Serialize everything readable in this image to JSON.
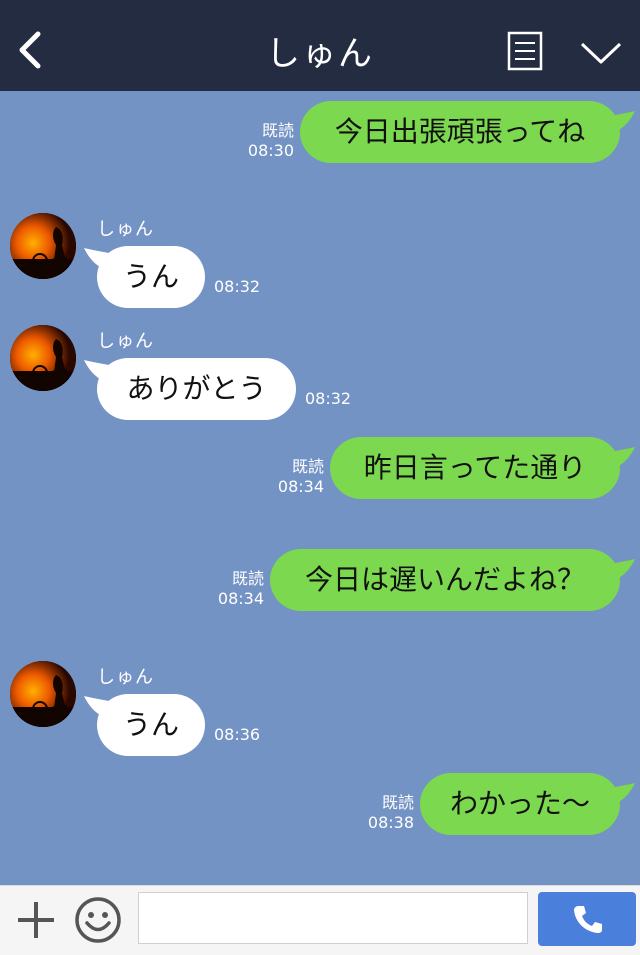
{
  "header": {
    "title": "しゅん"
  },
  "colors": {
    "background": "#7493c5",
    "outgoing": "#7cd84e",
    "incoming": "#ffffff",
    "header": "#232c40",
    "send": "#4a7fdc"
  },
  "messages": [
    {
      "dir": "out",
      "text": "今日出張頑張ってね",
      "read": "既読",
      "time": "08:30"
    },
    {
      "dir": "in",
      "sender": "しゅん",
      "text": "うん",
      "time": "08:32"
    },
    {
      "dir": "in",
      "sender": "しゅん",
      "text": "ありがとう",
      "time": "08:32"
    },
    {
      "dir": "out",
      "text": "昨日言ってた通り",
      "read": "既読",
      "time": "08:34"
    },
    {
      "dir": "out",
      "text": "今日は遅いんだよね？",
      "read": "既読",
      "time": "08:34"
    },
    {
      "dir": "in",
      "sender": "しゅん",
      "text": "うん",
      "time": "08:36"
    },
    {
      "dir": "out",
      "text": "わかった〜",
      "read": "既読",
      "time": "08:38"
    }
  ],
  "composer": {
    "value": ""
  },
  "icons": [
    "back-icon",
    "memo-icon",
    "chevron-down-icon",
    "plus-icon",
    "smile-icon",
    "phone-icon"
  ]
}
